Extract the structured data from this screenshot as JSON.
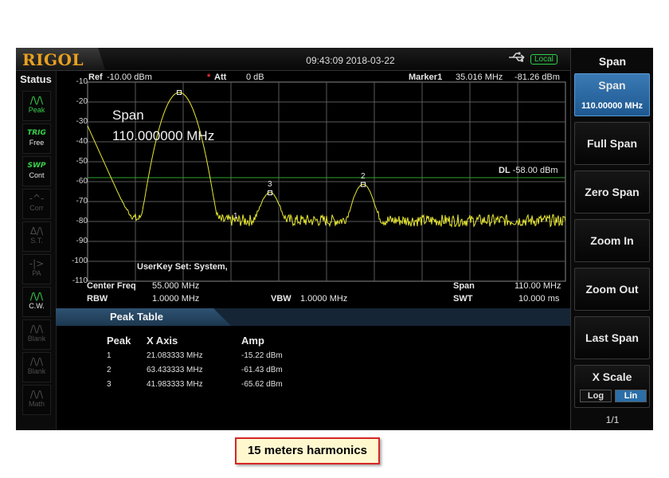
{
  "header": {
    "logo": "RIGOL",
    "datetime": "09:43:09 2018-03-22",
    "usb_icon": "usb-icon",
    "mode_badge": "Local",
    "colors": {
      "logo": "#e8a020",
      "badge": "#2fd04a"
    }
  },
  "status_panel": {
    "title": "Status",
    "items": [
      {
        "glyph": "/\\/\\",
        "label": "Peak",
        "active": true
      },
      {
        "glyph": "TRIG",
        "label": "Free",
        "active": true
      },
      {
        "glyph": "SWP",
        "label": "Cont",
        "active": true
      },
      {
        "glyph": "-^-",
        "label": "Corr",
        "active": false
      },
      {
        "glyph": "Δ/\\",
        "label": "S.T.",
        "active": false
      },
      {
        "glyph": "-|>",
        "label": "PA",
        "active": false
      },
      {
        "glyph": "/\\/\\",
        "label": "C.W.",
        "active": true
      },
      {
        "glyph": "/\\/\\",
        "label": "Blank",
        "active": false
      },
      {
        "glyph": "/\\/\\",
        "label": "Blank",
        "active": false
      },
      {
        "glyph": "/\\/\\",
        "label": "Math",
        "active": false
      }
    ]
  },
  "plot": {
    "ref_label": "Ref",
    "ref_value": "-10.00 dBm",
    "att_marker": "*",
    "att_label": "Att",
    "att_value": "0 dB",
    "marker_label": "Marker1",
    "marker_freq": "35.016 MHz",
    "marker_amp": "-81.26 dBm",
    "overlay_title": "Span",
    "overlay_value": "110.000000 MHz",
    "display_line_label": "DL",
    "display_line_value": "-58.00 dBm",
    "userkey": "UserKey Set:   System,",
    "y_ticks": [
      "-10",
      "-20",
      "-30",
      "-40",
      "-50",
      "-60",
      "-70",
      "-80",
      "-90",
      "-100",
      "-110"
    ],
    "peak_markers": [
      "1",
      "2",
      "3"
    ],
    "colors": {
      "trace": "#e8e832",
      "display_line": "#2ea22e",
      "grid": "#5a5a5a"
    }
  },
  "chart_data": {
    "type": "line",
    "x_range_mhz": [
      0,
      110
    ],
    "ylim": [
      -110,
      -10
    ],
    "ylabel": "dBm",
    "noise_floor_dbm": -79.5,
    "peaks": [
      {
        "label": "1",
        "x_mhz": 21.083333,
        "amp_dbm": -15.22
      },
      {
        "label": "2",
        "x_mhz": 63.433333,
        "amp_dbm": -61.43
      },
      {
        "label": "3",
        "x_mhz": 41.983333,
        "amp_dbm": -65.62
      }
    ],
    "display_line_dbm": -58.0,
    "marker1": {
      "x_mhz": 35.016,
      "amp_dbm": -81.26
    }
  },
  "params": {
    "center_freq_label": "Center Freq",
    "center_freq_value": "55.000 MHz",
    "rbw_label": "RBW",
    "rbw_value": "1.0000 MHz",
    "vbw_label": "VBW",
    "vbw_value": "1.0000 MHz",
    "span_label": "Span",
    "span_value": "110.00 MHz",
    "swt_label": "SWT",
    "swt_value": "10.000 ms"
  },
  "peak_table": {
    "title": "Peak Table",
    "columns": [
      "Peak",
      "X Axis",
      "Amp"
    ],
    "rows": [
      [
        "1",
        "21.083333 MHz",
        "-15.22 dBm"
      ],
      [
        "2",
        "63.433333 MHz",
        "-61.43 dBm"
      ],
      [
        "3",
        "41.983333 MHz",
        "-65.62 dBm"
      ]
    ]
  },
  "menu": {
    "title": "Span",
    "span_button": {
      "label": "Span",
      "value": "110.00000 MHz"
    },
    "buttons": [
      "Full Span",
      "Zero Span",
      "Zoom In",
      "Zoom Out",
      "Last Span"
    ],
    "xscale": {
      "label": "X Scale",
      "options": [
        "Log",
        "Lin"
      ],
      "selected": "Lin"
    },
    "page": "1/1"
  },
  "caption": "15 meters harmonics"
}
